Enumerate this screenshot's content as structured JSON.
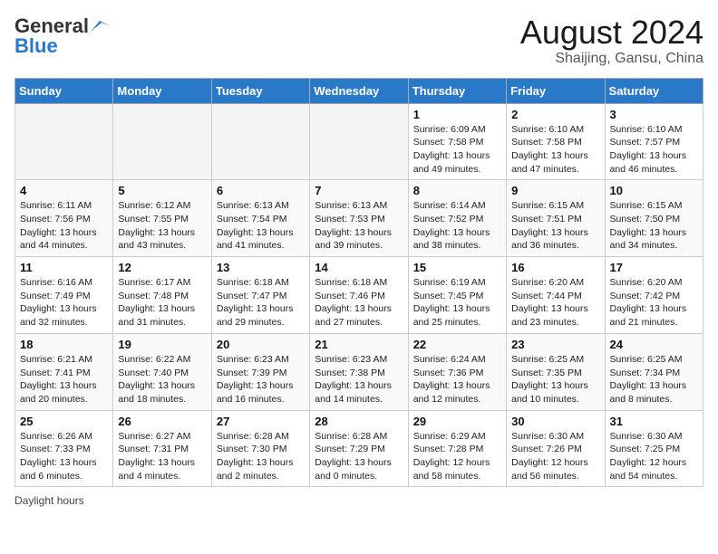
{
  "header": {
    "logo_line1": "General",
    "logo_line2": "Blue",
    "month_title": "August 2024",
    "subtitle": "Shaijing, Gansu, China"
  },
  "days_of_week": [
    "Sunday",
    "Monday",
    "Tuesday",
    "Wednesday",
    "Thursday",
    "Friday",
    "Saturday"
  ],
  "weeks": [
    [
      {
        "day": "",
        "info": ""
      },
      {
        "day": "",
        "info": ""
      },
      {
        "day": "",
        "info": ""
      },
      {
        "day": "",
        "info": ""
      },
      {
        "day": "1",
        "info": "Sunrise: 6:09 AM\nSunset: 7:58 PM\nDaylight: 13 hours and 49 minutes."
      },
      {
        "day": "2",
        "info": "Sunrise: 6:10 AM\nSunset: 7:58 PM\nDaylight: 13 hours and 47 minutes."
      },
      {
        "day": "3",
        "info": "Sunrise: 6:10 AM\nSunset: 7:57 PM\nDaylight: 13 hours and 46 minutes."
      }
    ],
    [
      {
        "day": "4",
        "info": "Sunrise: 6:11 AM\nSunset: 7:56 PM\nDaylight: 13 hours and 44 minutes."
      },
      {
        "day": "5",
        "info": "Sunrise: 6:12 AM\nSunset: 7:55 PM\nDaylight: 13 hours and 43 minutes."
      },
      {
        "day": "6",
        "info": "Sunrise: 6:13 AM\nSunset: 7:54 PM\nDaylight: 13 hours and 41 minutes."
      },
      {
        "day": "7",
        "info": "Sunrise: 6:13 AM\nSunset: 7:53 PM\nDaylight: 13 hours and 39 minutes."
      },
      {
        "day": "8",
        "info": "Sunrise: 6:14 AM\nSunset: 7:52 PM\nDaylight: 13 hours and 38 minutes."
      },
      {
        "day": "9",
        "info": "Sunrise: 6:15 AM\nSunset: 7:51 PM\nDaylight: 13 hours and 36 minutes."
      },
      {
        "day": "10",
        "info": "Sunrise: 6:15 AM\nSunset: 7:50 PM\nDaylight: 13 hours and 34 minutes."
      }
    ],
    [
      {
        "day": "11",
        "info": "Sunrise: 6:16 AM\nSunset: 7:49 PM\nDaylight: 13 hours and 32 minutes."
      },
      {
        "day": "12",
        "info": "Sunrise: 6:17 AM\nSunset: 7:48 PM\nDaylight: 13 hours and 31 minutes."
      },
      {
        "day": "13",
        "info": "Sunrise: 6:18 AM\nSunset: 7:47 PM\nDaylight: 13 hours and 29 minutes."
      },
      {
        "day": "14",
        "info": "Sunrise: 6:18 AM\nSunset: 7:46 PM\nDaylight: 13 hours and 27 minutes."
      },
      {
        "day": "15",
        "info": "Sunrise: 6:19 AM\nSunset: 7:45 PM\nDaylight: 13 hours and 25 minutes."
      },
      {
        "day": "16",
        "info": "Sunrise: 6:20 AM\nSunset: 7:44 PM\nDaylight: 13 hours and 23 minutes."
      },
      {
        "day": "17",
        "info": "Sunrise: 6:20 AM\nSunset: 7:42 PM\nDaylight: 13 hours and 21 minutes."
      }
    ],
    [
      {
        "day": "18",
        "info": "Sunrise: 6:21 AM\nSunset: 7:41 PM\nDaylight: 13 hours and 20 minutes."
      },
      {
        "day": "19",
        "info": "Sunrise: 6:22 AM\nSunset: 7:40 PM\nDaylight: 13 hours and 18 minutes."
      },
      {
        "day": "20",
        "info": "Sunrise: 6:23 AM\nSunset: 7:39 PM\nDaylight: 13 hours and 16 minutes."
      },
      {
        "day": "21",
        "info": "Sunrise: 6:23 AM\nSunset: 7:38 PM\nDaylight: 13 hours and 14 minutes."
      },
      {
        "day": "22",
        "info": "Sunrise: 6:24 AM\nSunset: 7:36 PM\nDaylight: 13 hours and 12 minutes."
      },
      {
        "day": "23",
        "info": "Sunrise: 6:25 AM\nSunset: 7:35 PM\nDaylight: 13 hours and 10 minutes."
      },
      {
        "day": "24",
        "info": "Sunrise: 6:25 AM\nSunset: 7:34 PM\nDaylight: 13 hours and 8 minutes."
      }
    ],
    [
      {
        "day": "25",
        "info": "Sunrise: 6:26 AM\nSunset: 7:33 PM\nDaylight: 13 hours and 6 minutes."
      },
      {
        "day": "26",
        "info": "Sunrise: 6:27 AM\nSunset: 7:31 PM\nDaylight: 13 hours and 4 minutes."
      },
      {
        "day": "27",
        "info": "Sunrise: 6:28 AM\nSunset: 7:30 PM\nDaylight: 13 hours and 2 minutes."
      },
      {
        "day": "28",
        "info": "Sunrise: 6:28 AM\nSunset: 7:29 PM\nDaylight: 13 hours and 0 minutes."
      },
      {
        "day": "29",
        "info": "Sunrise: 6:29 AM\nSunset: 7:28 PM\nDaylight: 12 hours and 58 minutes."
      },
      {
        "day": "30",
        "info": "Sunrise: 6:30 AM\nSunset: 7:26 PM\nDaylight: 12 hours and 56 minutes."
      },
      {
        "day": "31",
        "info": "Sunrise: 6:30 AM\nSunset: 7:25 PM\nDaylight: 12 hours and 54 minutes."
      }
    ]
  ],
  "legend": {
    "daylight_hours_label": "Daylight hours"
  }
}
